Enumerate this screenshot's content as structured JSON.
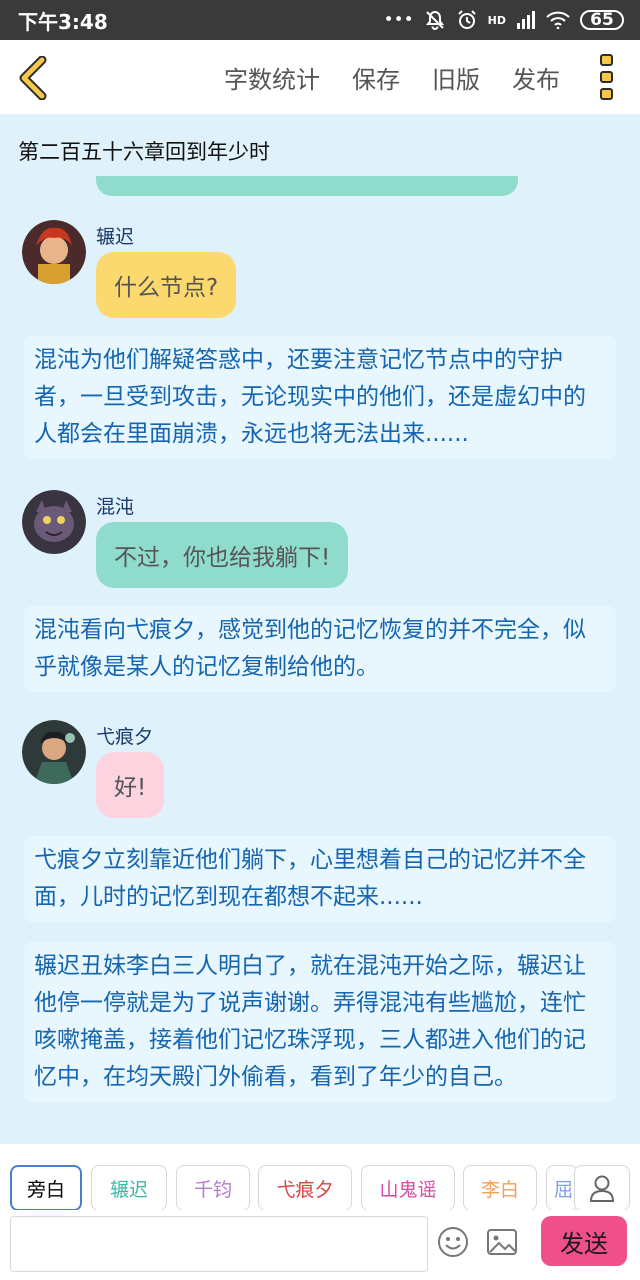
{
  "status_bar": {
    "time": "下午3:48",
    "hd_label": "HD",
    "battery": "65"
  },
  "toolbar": {
    "word_count_label": "字数统计",
    "save_label": "保存",
    "old_version_label": "旧版",
    "publish_label": "发布"
  },
  "chapter": {
    "title": "第二百五十六章回到年少时"
  },
  "messages": [
    {
      "speaker": "辗迟",
      "text": "什么节点?",
      "bubble_color": "#fcd96e"
    },
    {
      "narration": "混沌为他们解疑答惑中，还要注意记忆节点中的守护者，一旦受到攻击，无论现实中的他们，还是虚幻中的人都会在里面崩溃，永远也将无法出来......"
    },
    {
      "speaker": "混沌",
      "text": "不过，你也给我躺下!",
      "bubble_color": "#8fdccd"
    },
    {
      "narration": "混沌看向弋痕夕，感觉到他的记忆恢复的并不完全，似乎就像是某人的记忆复制给他的。"
    },
    {
      "speaker": "弋痕夕",
      "text": "好!",
      "bubble_color": "#fcd3de"
    },
    {
      "narration": "弋痕夕立刻靠近他们躺下，心里想着自己的记忆并不全面，儿时的记忆到现在都想不起来......"
    },
    {
      "narration": "辗迟丑妹李白三人明白了，就在混沌开始之际，辗迟让他停一停就是为了说声谢谢。弄得混沌有些尴尬，连忙咳嗽掩盖，接着他们记忆珠浮现，三人都进入他们的记忆中，在均天殿门外偷看，看到了年少的自己。"
    }
  ],
  "characters": [
    {
      "name": "旁白",
      "color": "#555555",
      "selected": true
    },
    {
      "name": "辗迟",
      "color": "#3bb9a8",
      "selected": false
    },
    {
      "name": "千钧",
      "color": "#b57ad6",
      "selected": false
    },
    {
      "name": "弋痕夕",
      "color": "#d94343",
      "selected": false
    },
    {
      "name": "山鬼谣",
      "color": "#d94aa6",
      "selected": false
    },
    {
      "name": "李白",
      "color": "#f0a05a",
      "selected": false
    },
    {
      "name": "屈",
      "color": "#7aa0e0",
      "selected": false
    }
  ],
  "composer": {
    "input_value": "",
    "send_label": "发送"
  },
  "colors": {
    "background": "#dff1fb",
    "narration_text": "#1565b0",
    "send_button": "#f0508a",
    "selected_chip_border": "#4a7fd0"
  }
}
